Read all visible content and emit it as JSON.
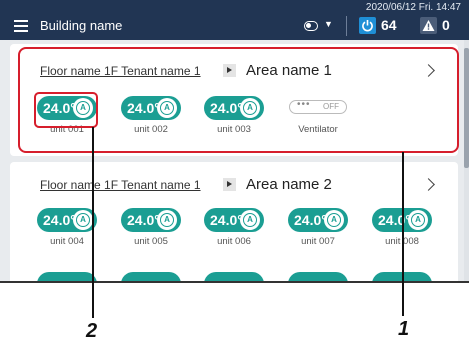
{
  "header": {
    "building_name": "Building name",
    "datetime": "2020/06/12 Fri. 14:47",
    "power_count": "64",
    "alert_count": "0",
    "icons": [
      "menu-icon",
      "mode-toggle-icon",
      "power-icon",
      "alert-icon"
    ]
  },
  "areas": [
    {
      "floor_title": "Floor name 1F Tenant name 1",
      "area_name": "Area name 1",
      "units": [
        {
          "temp": "24.0",
          "unit": "°",
          "mode": "A",
          "label": "unit 001"
        },
        {
          "temp": "24.0",
          "unit": "°",
          "mode": "A",
          "label": "unit 002"
        },
        {
          "temp": "24.0",
          "unit": "°",
          "mode": "A",
          "label": "unit 003"
        }
      ],
      "ventilator": {
        "dots": "•••",
        "state": "OFF",
        "label": "Ventilator"
      }
    },
    {
      "floor_title": "Floor name 1F Tenant name 1",
      "area_name": "Area name 2",
      "units": [
        {
          "temp": "24.0",
          "unit": "°",
          "mode": "A",
          "label": "unit 004"
        },
        {
          "temp": "24.0",
          "unit": "°",
          "mode": "A",
          "label": "unit 005"
        },
        {
          "temp": "24.0",
          "unit": "°",
          "mode": "A",
          "label": "unit 006"
        },
        {
          "temp": "24.0",
          "unit": "°",
          "mode": "A",
          "label": "unit 007"
        },
        {
          "temp": "24.0",
          "unit": "°",
          "mode": "A",
          "label": "unit 008"
        }
      ]
    }
  ],
  "callouts": {
    "one": "1",
    "two": "2"
  },
  "colors": {
    "header": "#213553",
    "unit_pill": "#1b9e93",
    "callout": "#d61e2c",
    "power_badge": "#1f8fd6"
  }
}
